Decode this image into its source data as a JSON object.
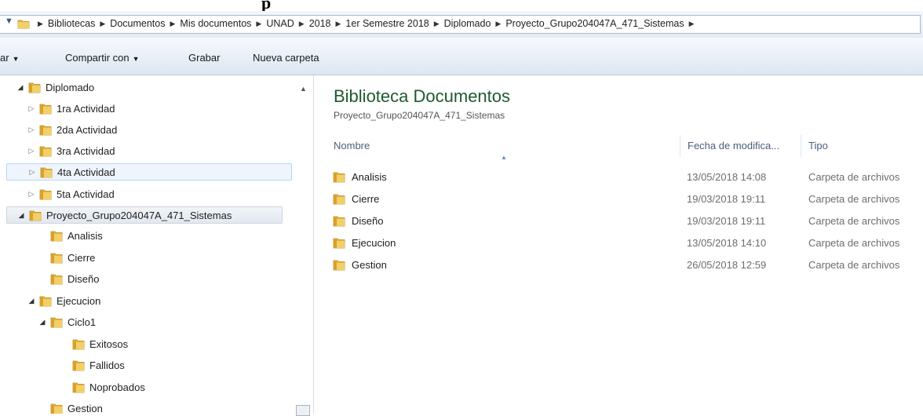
{
  "colors": {
    "folder": "#e8b73c",
    "library_title": "#1e5a2e",
    "header_text": "#4c607a"
  },
  "address": {
    "back_icon": "nav-arrow-icon",
    "crumbs": [
      "Bibliotecas",
      "Documentos",
      "Mis documentos",
      "UNAD",
      "2018",
      "1er Semestre 2018",
      "Diplomado",
      "Proyecto_Grupo204047A_471_Sistemas"
    ]
  },
  "toolbar": {
    "organize": "ar",
    "share": "Compartir con",
    "burn": "Grabar",
    "new_folder": "Nueva carpeta"
  },
  "tree": [
    {
      "label": "Diplomado",
      "state": "open"
    },
    {
      "label": "1ra Actividad",
      "state": "closed"
    },
    {
      "label": "2da Actividad",
      "state": "closed"
    },
    {
      "label": "3ra Actividad",
      "state": "closed"
    },
    {
      "label": "4ta Actividad",
      "state": "closed"
    },
    {
      "label": "5ta Actividad",
      "state": "closed"
    },
    {
      "label": "Proyecto_Grupo204047A_471_Sistemas",
      "state": "open"
    },
    {
      "label": "Analisis",
      "state": "none"
    },
    {
      "label": "Cierre",
      "state": "none"
    },
    {
      "label": "Diseño",
      "state": "none"
    },
    {
      "label": "Ejecucion",
      "state": "open"
    },
    {
      "label": "Ciclo1",
      "state": "open"
    },
    {
      "label": "Exitosos",
      "state": "none"
    },
    {
      "label": "Fallidos",
      "state": "none"
    },
    {
      "label": "Noprobados",
      "state": "none"
    },
    {
      "label": "Gestion",
      "state": "none"
    }
  ],
  "content": {
    "title": "Biblioteca Documentos",
    "subtitle": "Proyecto_Grupo204047A_471_Sistemas",
    "columns": {
      "name": "Nombre",
      "date": "Fecha de modifica...",
      "type": "Tipo"
    },
    "rows": [
      {
        "name": "Analisis",
        "date": "13/05/2018 14:08",
        "type": "Carpeta de archivos"
      },
      {
        "name": "Cierre",
        "date": "19/03/2018 19:11",
        "type": "Carpeta de archivos"
      },
      {
        "name": "Diseño",
        "date": "19/03/2018 19:11",
        "type": "Carpeta de archivos"
      },
      {
        "name": "Ejecucion",
        "date": "13/05/2018 14:10",
        "type": "Carpeta de archivos"
      },
      {
        "name": "Gestion",
        "date": "26/05/2018 12:59",
        "type": "Carpeta de archivos"
      }
    ]
  }
}
